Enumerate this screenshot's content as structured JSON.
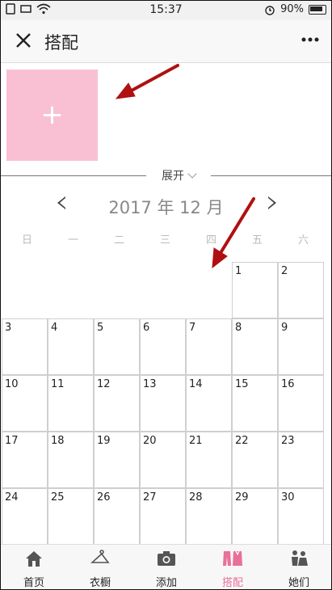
{
  "status_bar": {
    "time": "15:37",
    "battery": "90%"
  },
  "header": {
    "title": "搭配"
  },
  "add_tile": {
    "label": "+"
  },
  "expand": {
    "label": "展开"
  },
  "calendar": {
    "month_label": "2017 年 12 月",
    "weekdays": [
      "日",
      "一",
      "二",
      "三",
      "四",
      "五",
      "六"
    ],
    "weeks": [
      [
        "",
        "",
        "",
        "",
        "",
        "1",
        "2"
      ],
      [
        "3",
        "4",
        "5",
        "6",
        "7",
        "8",
        "9"
      ],
      [
        "10",
        "11",
        "12",
        "13",
        "14",
        "15",
        "16"
      ],
      [
        "17",
        "18",
        "19",
        "20",
        "21",
        "22",
        "23"
      ],
      [
        "24",
        "25",
        "26",
        "27",
        "28",
        "29",
        "30"
      ]
    ]
  },
  "tabbar": {
    "items": [
      {
        "label": "首页",
        "icon": "home-icon"
      },
      {
        "label": "衣橱",
        "icon": "hanger-icon"
      },
      {
        "label": "添加",
        "icon": "camera-icon"
      },
      {
        "label": "搭配",
        "icon": "outfit-icon",
        "active": true
      },
      {
        "label": "她们",
        "icon": "people-icon"
      }
    ]
  },
  "colors": {
    "accent": "#e8709a",
    "add_tile": "#f9c0d4",
    "annotation_arrow": "#b01010"
  }
}
